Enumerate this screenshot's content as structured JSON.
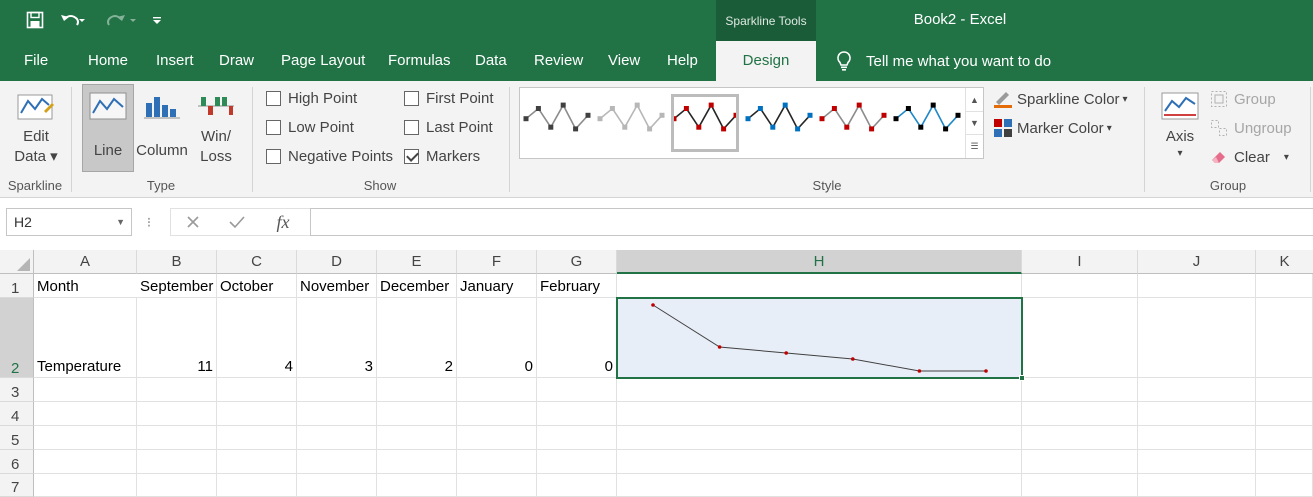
{
  "titlebar": {
    "context_tools": "Sparkline Tools",
    "app_title": "Book2  -  Excel",
    "qat": {
      "save_icon": "save-icon",
      "undo_icon": "undo-icon",
      "redo_icon": "redo-icon",
      "customize_icon": "customize-qat-icon"
    }
  },
  "tabs": [
    "File",
    "Home",
    "Insert",
    "Draw",
    "Page Layout",
    "Formulas",
    "Data",
    "Review",
    "View",
    "Help",
    "Design"
  ],
  "active_tab": "Design",
  "tell_me": "Tell me what you want to do",
  "ribbon": {
    "sparkline": {
      "edit_data_1": "Edit",
      "edit_data_2": "Data",
      "group": "Sparkline"
    },
    "type": {
      "line": "Line",
      "column": "Column",
      "winloss_1": "Win/",
      "winloss_2": "Loss",
      "group": "Type",
      "selected": "Line"
    },
    "show": {
      "high_point": "High Point",
      "low_point": "Low Point",
      "negative_points": "Negative Points",
      "first_point": "First Point",
      "last_point": "Last Point",
      "markers": "Markers",
      "checked": {
        "high_point": false,
        "low_point": false,
        "negative_points": false,
        "first_point": false,
        "last_point": false,
        "markers": true
      },
      "group": "Show"
    },
    "style": {
      "sparkline_color": "Sparkline Color",
      "marker_color": "Marker Color",
      "group": "Style",
      "thumbnails": [
        {
          "line": "#8c8c8c",
          "marker": "#404040"
        },
        {
          "line": "#b7b7b7",
          "marker": "#b7b7b7"
        },
        {
          "line": "#262626",
          "marker": "#c00000"
        },
        {
          "line": "#262626",
          "marker": "#0070c0"
        },
        {
          "line": "#8c8c8c",
          "marker": "#c00000"
        },
        {
          "line": "#1f88c8",
          "marker": "#000000"
        }
      ],
      "selected_thumbnail": 2
    },
    "group": {
      "axis": "Axis",
      "group": "Group",
      "ungroup": "Ungroup",
      "clear": "Clear",
      "group_label": "Group"
    }
  },
  "formula_bar": {
    "name_box": "H2",
    "cancel_icon": "cancel-icon",
    "enter_icon": "enter-icon",
    "fx": "fx",
    "value": ""
  },
  "grid": {
    "columns": [
      "A",
      "B",
      "C",
      "D",
      "E",
      "F",
      "G",
      "H",
      "I",
      "J",
      "K"
    ],
    "rows": [
      "1",
      "2",
      "3",
      "4",
      "5",
      "6",
      "7"
    ],
    "selected_cell": "H2",
    "row1": [
      "Month",
      "September",
      "October",
      "November",
      "December",
      "January",
      "February"
    ],
    "row2_label": "Temperature",
    "row2_values": [
      11,
      4,
      3,
      2,
      0,
      0
    ]
  },
  "sparkline_data": {
    "type": "line",
    "values": [
      11,
      4,
      3,
      2,
      0,
      0
    ],
    "line_color": "#404040",
    "marker_color": "#c00000"
  },
  "colors": {
    "excel_green": "#217346",
    "ribbon_bg": "#f3f3f3"
  }
}
